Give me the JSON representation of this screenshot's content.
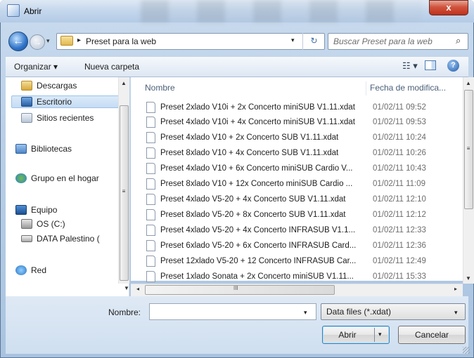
{
  "window": {
    "title": "Abrir",
    "close_label": "x"
  },
  "nav": {
    "back_glyph": "←",
    "forward_glyph": "→",
    "breadcrumb_arrow": "▸",
    "breadcrumb": "Preset para la web",
    "dropdown_glyph": "▾",
    "refresh_glyph": "↻",
    "search_placeholder": "Buscar Preset para la web",
    "search_glyph": "⌕"
  },
  "toolbar": {
    "organize_label": "Organizar ▾",
    "new_folder_label": "Nueva carpeta",
    "view_glyph": "☷ ▾",
    "help_glyph": "?"
  },
  "sidebar": {
    "items": [
      {
        "label": "Descargas",
        "icon": "downloads-folder-icon"
      },
      {
        "label": "Escritorio",
        "icon": "desktop-icon"
      },
      {
        "label": "Sitios recientes",
        "icon": "recent-places-icon"
      },
      {
        "label": "Bibliotecas",
        "icon": "libraries-icon"
      },
      {
        "label": "Grupo en el hogar",
        "icon": "homegroup-icon"
      },
      {
        "label": "Equipo",
        "icon": "computer-icon"
      },
      {
        "label": "OS (C:)",
        "icon": "drive-c-icon"
      },
      {
        "label": "DATA Palestino (",
        "icon": "drive-data-icon"
      },
      {
        "label": "Red",
        "icon": "network-icon"
      }
    ],
    "selected_index": 1
  },
  "file_list": {
    "columns": [
      "Nombre",
      "Fecha de modifica..."
    ],
    "rows": [
      {
        "name": "Preset 2xlado V10i + 2x Concerto miniSUB V1.11.xdat",
        "date": "01/02/11 09:52"
      },
      {
        "name": "Preset 4xlado V10i + 4x Concerto miniSUB V1.11.xdat",
        "date": "01/02/11 09:53"
      },
      {
        "name": "Preset 4xlado V10 + 2x Concerto SUB V1.11.xdat",
        "date": "01/02/11 10:24"
      },
      {
        "name": "Preset 8xlado V10 + 4x Concerto SUB V1.11.xdat",
        "date": "01/02/11 10:26"
      },
      {
        "name": "Preset 4xlado V10 + 6x Concerto miniSUB Cardio V...",
        "date": "01/02/11 10:43"
      },
      {
        "name": "Preset 8xlado V10 + 12x Concerto miniSUB Cardio ...",
        "date": "01/02/11 11:09"
      },
      {
        "name": "Preset 4xlado V5-20 + 4x Concerto SUB V1.11.xdat",
        "date": "01/02/11 12:10"
      },
      {
        "name": "Preset 8xlado V5-20 + 8x Concerto SUB V1.11.xdat",
        "date": "01/02/11 12:12"
      },
      {
        "name": "Preset 4xlado V5-20 + 4x Concerto INFRASUB V1.1...",
        "date": "01/02/11 12:33"
      },
      {
        "name": "Preset 6xlado V5-20 + 6x Concerto INFRASUB Card...",
        "date": "01/02/11 12:36"
      },
      {
        "name": "Preset 12xlado V5-20 + 12 Concerto INFRASUB Car...",
        "date": "01/02/11 12:49"
      },
      {
        "name": "Preset 1xlado Sonata + 2x Concerto miniSUB V1.11...",
        "date": "01/02/11 15:33"
      }
    ]
  },
  "scroll": {
    "up": "▲",
    "down": "▼",
    "left": "◂",
    "right": "▸",
    "grip": "≡",
    "grip_h": "III"
  },
  "footer": {
    "name_label": "Nombre:",
    "name_value": "",
    "type_value": "Data files (*.xdat)",
    "dropdown_glyph": "▾",
    "open_label": "Abrir",
    "open_drop_glyph": "▾",
    "cancel_label": "Cancelar"
  }
}
